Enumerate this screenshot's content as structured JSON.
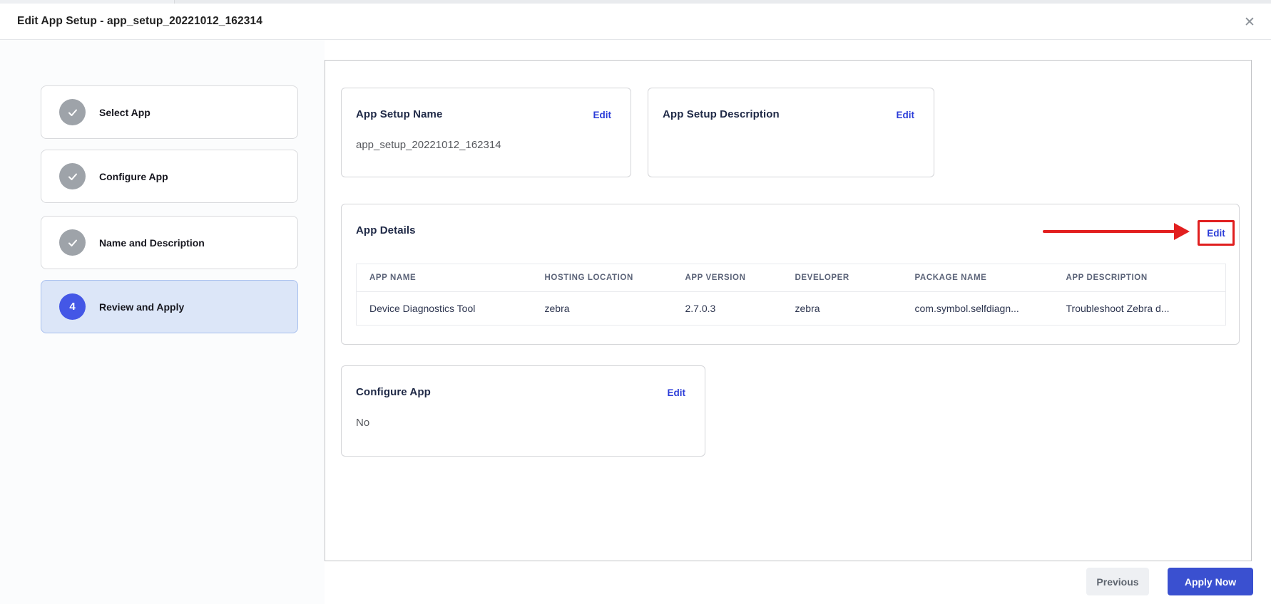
{
  "header": {
    "title": "Edit App Setup - app_setup_20221012_162314",
    "close_icon": "✕"
  },
  "stepper": {
    "steps": [
      {
        "label": "Select App",
        "status": "completed"
      },
      {
        "label": "Configure App",
        "status": "completed"
      },
      {
        "label": "Name and Description",
        "status": "completed"
      },
      {
        "label": "Review and Apply",
        "status": "active",
        "number": "4"
      }
    ]
  },
  "review": {
    "app_setup_name": {
      "title": "App Setup Name",
      "edit_label": "Edit",
      "value": "app_setup_20221012_162314"
    },
    "app_setup_description": {
      "title": "App Setup Description",
      "edit_label": "Edit",
      "value": ""
    },
    "app_details": {
      "title": "App Details",
      "edit_label": "Edit",
      "highlighted": true,
      "table": {
        "columns": [
          "APP NAME",
          "HOSTING LOCATION",
          "APP VERSION",
          "DEVELOPER",
          "PACKAGE NAME",
          "APP DESCRIPTION"
        ],
        "rows": [
          [
            "Device Diagnostics Tool",
            "zebra",
            "2.7.0.3",
            "zebra",
            "com.symbol.selfdiagn...",
            "Troubleshoot Zebra d..."
          ]
        ]
      }
    },
    "configure_app": {
      "title": "Configure App",
      "edit_label": "Edit",
      "value": "No"
    }
  },
  "footer": {
    "previous_label": "Previous",
    "apply_label": "Apply Now"
  },
  "colors": {
    "link_blue": "#2b3cd8",
    "primary_button_blue": "#3a50d0",
    "active_step_circle": "#4457e6",
    "active_step_bg": "#dce6f8",
    "active_step_border": "#a8c0ee",
    "completed_step_gray": "#9ea3a9",
    "annotation_red": "#e21f1f"
  }
}
